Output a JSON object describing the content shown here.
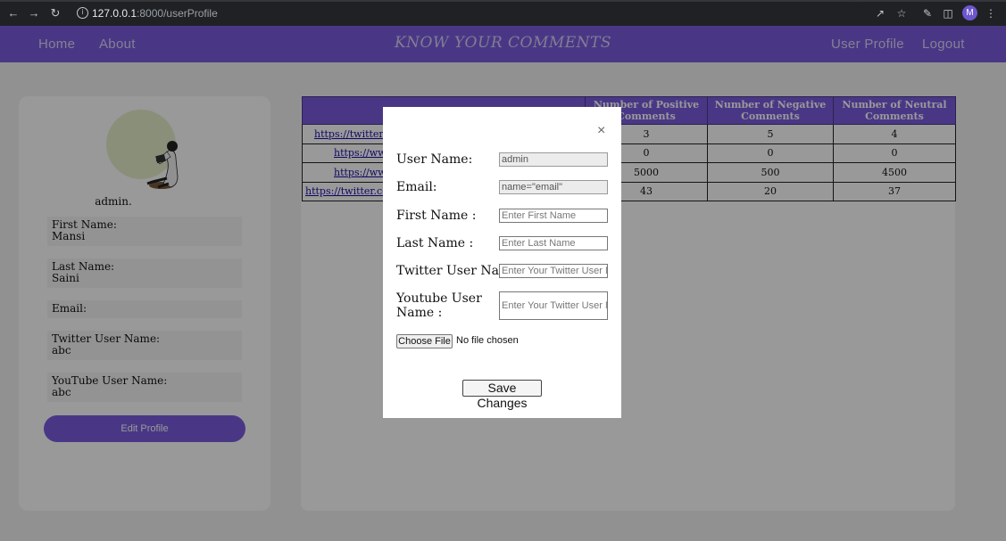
{
  "browser": {
    "url_host": "127.0.0.1",
    "url_path": ":8000/userProfile",
    "profile_initial": "M"
  },
  "header": {
    "nav_left": [
      "Home",
      "About"
    ],
    "brand": "KNOW YOUR COMMENTS",
    "nav_right": [
      "User Profile",
      "Logout"
    ]
  },
  "profile": {
    "username": "admin.",
    "fields": [
      {
        "label": "First Name:",
        "value": "Mansi"
      },
      {
        "label": "Last Name:",
        "value": "Saini"
      },
      {
        "label": "Email:",
        "value": ""
      },
      {
        "label": "Twitter User Name:",
        "value": "abc"
      },
      {
        "label": "YouTube User Name:",
        "value": "abc"
      }
    ],
    "edit_button": "Edit Profile"
  },
  "table": {
    "headers": [
      "",
      "Number of Positive Comments",
      "Number of Negative Comments",
      "Number of Neutral Comments"
    ],
    "rows": [
      {
        "link": "https://twitter.co",
        "positive": "3",
        "negative": "5",
        "neutral": "4"
      },
      {
        "link": "https://www",
        "positive": "0",
        "negative": "0",
        "neutral": "0"
      },
      {
        "link": "https://www",
        "positive": "5000",
        "negative": "500",
        "neutral": "4500"
      },
      {
        "link": "https://twitter.com",
        "positive": "43",
        "negative": "20",
        "neutral": "37"
      }
    ]
  },
  "modal": {
    "close": "×",
    "username_label": "User Name:",
    "username_value": "admin",
    "email_label": "Email:",
    "email_value": "name=\"email\"",
    "first_name_label": "First Name :",
    "first_name_placeholder": "Enter First Name",
    "last_name_label": "Last Name :",
    "last_name_placeholder": "Enter Last Name",
    "twitter_label": "Twitter User Name:",
    "twitter_placeholder": "Enter Your Twitter User Name",
    "youtube_label": "Youtube User Name :",
    "youtube_placeholder": "Enter Your Twitter User Name",
    "choose_file": "Choose File",
    "no_file": "No file chosen",
    "save": "Save Changes"
  }
}
